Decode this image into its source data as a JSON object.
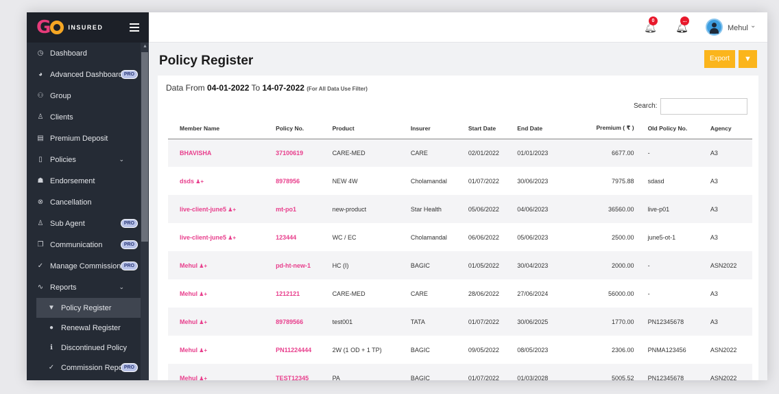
{
  "brand": {
    "logo_g": "G",
    "name": "INSURED"
  },
  "sidebar": {
    "items": [
      {
        "label": "Dashboard",
        "icon": "◷",
        "pro": ""
      },
      {
        "label": "Advanced Dashboard",
        "icon": "◕",
        "pro": "PRO"
      },
      {
        "label": "Group",
        "icon": "⚇",
        "pro": ""
      },
      {
        "label": "Clients",
        "icon": "♙",
        "pro": ""
      },
      {
        "label": "Premium Deposit",
        "icon": "▤",
        "pro": ""
      },
      {
        "label": "Policies",
        "icon": "▯",
        "pro": "",
        "chev": "⌄"
      },
      {
        "label": "Endorsement",
        "icon": "☗",
        "pro": ""
      },
      {
        "label": "Cancellation",
        "icon": "⊗",
        "pro": ""
      },
      {
        "label": "Sub Agent",
        "icon": "♙",
        "pro": "PRO"
      },
      {
        "label": "Communication",
        "icon": "❐",
        "pro": "PRO"
      },
      {
        "label": "Manage Commission",
        "icon": "✓",
        "pro": "PRO"
      },
      {
        "label": "Reports",
        "icon": "∿",
        "pro": "",
        "chev": "⌄"
      }
    ],
    "subitems": [
      {
        "label": "Policy Register",
        "icon": "▼",
        "pro": ""
      },
      {
        "label": "Renewal Register",
        "icon": "●",
        "pro": ""
      },
      {
        "label": "Discontinued Policy",
        "icon": "ℹ",
        "pro": ""
      },
      {
        "label": "Commission Report",
        "icon": "✓",
        "pro": "PRO"
      }
    ]
  },
  "topbar": {
    "notif_count": "0",
    "alert_count": "...",
    "user_name": "Mehul"
  },
  "page": {
    "title": "Policy Register",
    "export_label": "Export",
    "filter_icon": "filter-icon",
    "data_from_label": "Data From ",
    "date_from": "04-01-2022",
    "to_label": " To ",
    "date_to": "14-07-2022",
    "note": "(For All Data Use Filter)",
    "search_label": "Search:"
  },
  "table": {
    "headers": [
      "Member Name",
      "Policy No.",
      "Product",
      "Insurer",
      "Start Date",
      "End Date",
      "Premium ( ₹ )",
      "Old Policy No.",
      "Agency"
    ],
    "rows": [
      {
        "member": "BHAVISHA",
        "icon": false,
        "policy": "37100619",
        "product": "CARE-MED",
        "insurer": "CARE",
        "start": "02/01/2022",
        "end": "01/01/2023",
        "premium": "6677.00",
        "old": "-",
        "agency": "A3"
      },
      {
        "member": "dsds",
        "icon": true,
        "policy": "8978956",
        "product": "NEW 4W",
        "insurer": "Cholamandal",
        "start": "01/07/2022",
        "end": "30/06/2023",
        "premium": "7975.88",
        "old": "sdasd",
        "agency": "A3"
      },
      {
        "member": "live-client-june5",
        "icon": true,
        "policy": "mt-po1",
        "product": "new-product",
        "insurer": "Star Health",
        "start": "05/06/2022",
        "end": "04/06/2023",
        "premium": "36560.00",
        "old": "live-p01",
        "agency": "A3"
      },
      {
        "member": "live-client-june5",
        "icon": true,
        "policy": "123444",
        "product": "WC / EC",
        "insurer": "Cholamandal",
        "start": "06/06/2022",
        "end": "05/06/2023",
        "premium": "2500.00",
        "old": "june5-ot-1",
        "agency": "A3"
      },
      {
        "member": "Mehul",
        "icon": true,
        "policy": "pd-ht-new-1",
        "product": "HC (I)",
        "insurer": "BAGIC",
        "start": "01/05/2022",
        "end": "30/04/2023",
        "premium": "2000.00",
        "old": "-",
        "agency": "ASN2022"
      },
      {
        "member": "Mehul",
        "icon": true,
        "policy": "1212121",
        "product": "CARE-MED",
        "insurer": "CARE",
        "start": "28/06/2022",
        "end": "27/06/2024",
        "premium": "56000.00",
        "old": "-",
        "agency": "A3"
      },
      {
        "member": "Mehul",
        "icon": true,
        "policy": "89789566",
        "product": "test001",
        "insurer": "TATA",
        "start": "01/07/2022",
        "end": "30/06/2025",
        "premium": "1770.00",
        "old": "PN12345678",
        "agency": "A3"
      },
      {
        "member": "Mehul",
        "icon": true,
        "policy": "PN11224444",
        "product": "2W (1 OD + 1 TP)",
        "insurer": "BAGIC",
        "start": "09/05/2022",
        "end": "08/05/2023",
        "premium": "2306.00",
        "old": "PNMA123456",
        "agency": "ASN2022"
      },
      {
        "member": "Mehul",
        "icon": true,
        "policy": "TEST12345",
        "product": "PA",
        "insurer": "BAGIC",
        "start": "01/07/2022",
        "end": "01/03/2028",
        "premium": "5005.52",
        "old": "PN12345678",
        "agency": "ASN2022"
      }
    ]
  },
  "colors": {
    "accent": "#fbb51c",
    "link": "#e83e8c",
    "sidebar": "#252b35"
  }
}
